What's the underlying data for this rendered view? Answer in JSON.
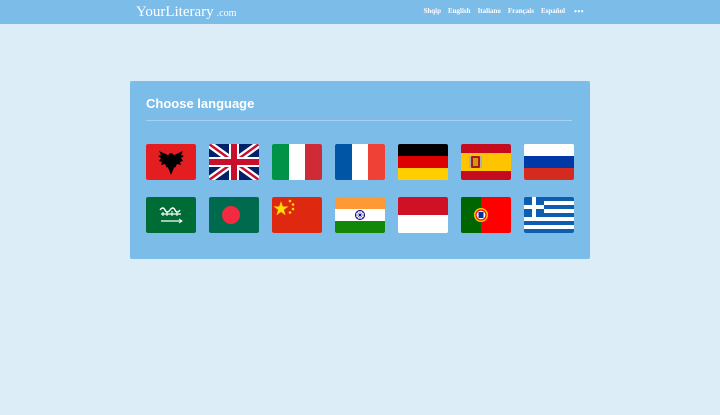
{
  "header": {
    "brand": "YourLiterary",
    "tld": ".com",
    "nav": [
      "Shqip",
      "English",
      "Italiano",
      "Français",
      "Español"
    ],
    "more": "•••"
  },
  "panel": {
    "title": "Choose language"
  },
  "flags": [
    {
      "icon": "albania-flag-icon"
    },
    {
      "icon": "united-kingdom-flag-icon"
    },
    {
      "icon": "italy-flag-icon"
    },
    {
      "icon": "france-flag-icon"
    },
    {
      "icon": "germany-flag-icon"
    },
    {
      "icon": "spain-flag-icon"
    },
    {
      "icon": "russia-flag-icon"
    },
    {
      "icon": "saudi-arabia-flag-icon"
    },
    {
      "icon": "bangladesh-flag-icon"
    },
    {
      "icon": "china-flag-icon"
    },
    {
      "icon": "india-flag-icon"
    },
    {
      "icon": "indonesia-flag-icon"
    },
    {
      "icon": "portugal-flag-icon"
    },
    {
      "icon": "greece-flag-icon"
    }
  ],
  "colors": {
    "background": "#dcedf8",
    "accent": "#7bbce8"
  }
}
